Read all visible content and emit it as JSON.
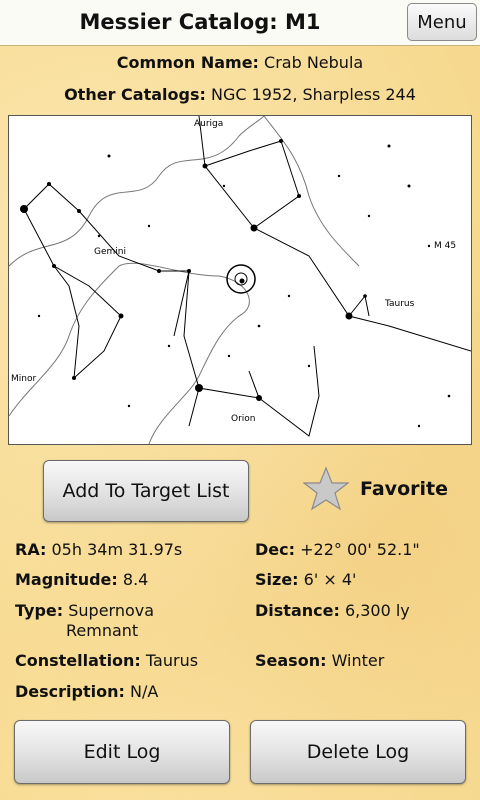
{
  "header": {
    "title": "Messier Catalog: M1",
    "menu_label": "Menu"
  },
  "object": {
    "common_name_label": "Common Name:",
    "common_name": "Crab Nebula",
    "other_catalogs_label": "Other Catalogs:",
    "other_catalogs": "NGC 1952, Sharpless 244"
  },
  "map": {
    "labels": [
      "Auriga",
      "Gemini",
      "Taurus",
      "M 45",
      "Orion",
      "Minor"
    ]
  },
  "actions": {
    "add_target_label": "Add To Target List",
    "favorite_label": "Favorite",
    "edit_log_label": "Edit Log",
    "delete_log_label": "Delete Log"
  },
  "details": {
    "ra_label": "RA:",
    "ra": "05h 34m 31.97s",
    "dec_label": "Dec:",
    "dec": "+22° 00' 52.1\"",
    "magnitude_label": "Magnitude:",
    "magnitude": "8.4",
    "size_label": "Size:",
    "size": "6' × 4'",
    "type_label": "Type:",
    "type_line1": "Supernova",
    "type_line2": "Remnant",
    "distance_label": "Distance:",
    "distance": "6,300 ly",
    "constellation_label": "Constellation:",
    "constellation": "Taurus",
    "season_label": "Season:",
    "season": "Winter",
    "description_label": "Description:",
    "description": "N/A"
  },
  "colors": {
    "background": "#f6d98e",
    "titlebar": "#fbfbf6"
  }
}
